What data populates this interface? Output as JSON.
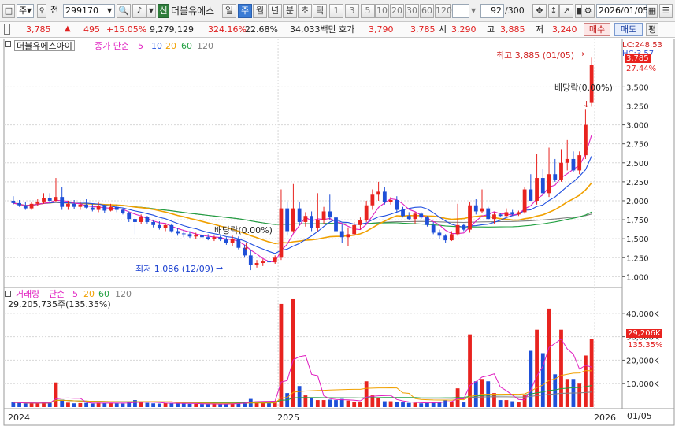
{
  "toolbar": {
    "market": "주",
    "prev_label": "전",
    "code": "299170",
    "sin_badge": "신",
    "stock_name": "더블유에스",
    "periods": [
      "일",
      "주",
      "월",
      "년",
      "분",
      "초",
      "틱"
    ],
    "active_period": "주",
    "minutes": [
      "1",
      "3",
      "5",
      "10",
      "20",
      "30",
      "60",
      "120"
    ],
    "count": "92",
    "total": "/300",
    "date": "2026/01/05"
  },
  "quote": {
    "price": "3,785",
    "change": "495",
    "change_pct": "+15.05%",
    "volume": "9,279,129",
    "vol_ratio": "324.16%",
    "turnover": "22.68%",
    "amount": "34,033백만",
    "ask_label": "호가",
    "ask": "3,790",
    "bid": "3,785",
    "open_label": "시",
    "open": "3,290",
    "high_label": "고",
    "high": "3,885",
    "low_label": "저",
    "low": "3,240",
    "buy_label": "매수",
    "sell_label": "매도",
    "eval_label": "평"
  },
  "price_panel": {
    "title": "더블유에스아이",
    "ma_label": "종가 단순",
    "ma_periods": [
      "5",
      "10",
      "20",
      "60",
      "120"
    ],
    "ma_colors": [
      "#e020c0",
      "#2050e0",
      "#f0a000",
      "#20a040",
      "#808080"
    ],
    "lc_label": "LC:248.53",
    "hc_label": "HC:3.57",
    "cur_price": "3,785",
    "cur_pct": "27.44%",
    "high_annot": "최고 3,885 (01/05)",
    "low_annot": "최저 1,086 (12/09)",
    "div_annot_right": "배당락(0.00%)",
    "div_annot_left": "배당락(0.00%)",
    "y_ticks": [
      "3,500",
      "3,250",
      "3,000",
      "2,750",
      "2,500",
      "2,250",
      "2,000",
      "1,750",
      "1,500",
      "1,250",
      "1,000"
    ]
  },
  "volume_panel": {
    "title": "거래량",
    "ma_label": "단순",
    "ma_periods": [
      "5",
      "20",
      "60",
      "120"
    ],
    "ma_colors": [
      "#e020c0",
      "#f0a000",
      "#20a040",
      "#808080"
    ],
    "summary": "29,205,735주(135.35%)",
    "cur_vol": "29,206K",
    "cur_pct": "135.35%",
    "y_ticks": [
      "40,000K",
      "30,000K",
      "20,000K",
      "10,000K"
    ]
  },
  "x_axis": {
    "labels": [
      "2024",
      "2025",
      "2026"
    ],
    "right_label": "01/05"
  },
  "colors": {
    "up": "#e8231f",
    "down": "#1e4fd8",
    "grid": "#d8d8d8",
    "panel_border": "#9a9a9a"
  },
  "chart_data": {
    "type": "candlestick",
    "period": "weekly",
    "x_range": [
      "2023-12",
      "2026-01-05"
    ],
    "price_ylim": [
      900,
      3950
    ],
    "volume_ylim": [
      0,
      47000
    ],
    "units": {
      "price": "KRW",
      "volume": "thousand shares"
    },
    "candles": [
      {
        "o": 2000,
        "h": 2060,
        "l": 1950,
        "c": 1970,
        "v": 2000
      },
      {
        "o": 1970,
        "h": 2010,
        "l": 1920,
        "c": 1940,
        "v": 1800
      },
      {
        "o": 1940,
        "h": 1990,
        "l": 1880,
        "c": 1900,
        "v": 1500
      },
      {
        "o": 1900,
        "h": 1990,
        "l": 1880,
        "c": 1960,
        "v": 1700
      },
      {
        "o": 1960,
        "h": 2020,
        "l": 1930,
        "c": 1990,
        "v": 1600
      },
      {
        "o": 1990,
        "h": 2100,
        "l": 1960,
        "c": 2040,
        "v": 2100
      },
      {
        "o": 2040,
        "h": 2100,
        "l": 1980,
        "c": 2000,
        "v": 1800
      },
      {
        "o": 2000,
        "h": 2300,
        "l": 1980,
        "c": 2050,
        "v": 10500
      },
      {
        "o": 2050,
        "h": 2180,
        "l": 1880,
        "c": 1920,
        "v": 3200
      },
      {
        "o": 1920,
        "h": 2000,
        "l": 1880,
        "c": 1960,
        "v": 1900
      },
      {
        "o": 1960,
        "h": 2010,
        "l": 1890,
        "c": 1920,
        "v": 1600
      },
      {
        "o": 1920,
        "h": 1980,
        "l": 1880,
        "c": 1950,
        "v": 1700
      },
      {
        "o": 1950,
        "h": 2020,
        "l": 1900,
        "c": 1910,
        "v": 1800
      },
      {
        "o": 1910,
        "h": 1960,
        "l": 1860,
        "c": 1880,
        "v": 1500
      },
      {
        "o": 1880,
        "h": 1990,
        "l": 1850,
        "c": 1930,
        "v": 1900
      },
      {
        "o": 1930,
        "h": 1950,
        "l": 1840,
        "c": 1870,
        "v": 1700
      },
      {
        "o": 1870,
        "h": 1960,
        "l": 1860,
        "c": 1920,
        "v": 1800
      },
      {
        "o": 1920,
        "h": 1950,
        "l": 1850,
        "c": 1880,
        "v": 1600
      },
      {
        "o": 1880,
        "h": 1900,
        "l": 1820,
        "c": 1840,
        "v": 1500
      },
      {
        "o": 1840,
        "h": 1860,
        "l": 1720,
        "c": 1760,
        "v": 2100
      },
      {
        "o": 1760,
        "h": 1780,
        "l": 1560,
        "c": 1720,
        "v": 3000
      },
      {
        "o": 1720,
        "h": 1820,
        "l": 1690,
        "c": 1790,
        "v": 2000
      },
      {
        "o": 1790,
        "h": 1800,
        "l": 1700,
        "c": 1720,
        "v": 1800
      },
      {
        "o": 1720,
        "h": 1740,
        "l": 1650,
        "c": 1680,
        "v": 1600
      },
      {
        "o": 1680,
        "h": 1730,
        "l": 1620,
        "c": 1640,
        "v": 1500
      },
      {
        "o": 1640,
        "h": 1700,
        "l": 1600,
        "c": 1680,
        "v": 1700
      },
      {
        "o": 1680,
        "h": 1700,
        "l": 1580,
        "c": 1600,
        "v": 1800
      },
      {
        "o": 1600,
        "h": 1640,
        "l": 1540,
        "c": 1570,
        "v": 1600
      },
      {
        "o": 1570,
        "h": 1620,
        "l": 1520,
        "c": 1560,
        "v": 1500
      },
      {
        "o": 1560,
        "h": 1600,
        "l": 1510,
        "c": 1530,
        "v": 1400
      },
      {
        "o": 1530,
        "h": 1580,
        "l": 1500,
        "c": 1550,
        "v": 1400
      },
      {
        "o": 1550,
        "h": 1580,
        "l": 1500,
        "c": 1520,
        "v": 1300
      },
      {
        "o": 1520,
        "h": 1560,
        "l": 1480,
        "c": 1500,
        "v": 1300
      },
      {
        "o": 1500,
        "h": 1540,
        "l": 1470,
        "c": 1520,
        "v": 1300
      },
      {
        "o": 1520,
        "h": 1540,
        "l": 1470,
        "c": 1490,
        "v": 1200
      },
      {
        "o": 1490,
        "h": 1520,
        "l": 1420,
        "c": 1440,
        "v": 1400
      },
      {
        "o": 1440,
        "h": 1540,
        "l": 1400,
        "c": 1500,
        "v": 1600
      },
      {
        "o": 1500,
        "h": 1530,
        "l": 1360,
        "c": 1380,
        "v": 2000
      },
      {
        "o": 1380,
        "h": 1420,
        "l": 1250,
        "c": 1280,
        "v": 2300
      },
      {
        "o": 1280,
        "h": 1360,
        "l": 1086,
        "c": 1150,
        "v": 3500
      },
      {
        "o": 1150,
        "h": 1220,
        "l": 1120,
        "c": 1180,
        "v": 2400
      },
      {
        "o": 1180,
        "h": 1230,
        "l": 1140,
        "c": 1200,
        "v": 2000
      },
      {
        "o": 1200,
        "h": 1260,
        "l": 1160,
        "c": 1190,
        "v": 2200
      },
      {
        "o": 1190,
        "h": 1280,
        "l": 1170,
        "c": 1250,
        "v": 2600
      },
      {
        "o": 1250,
        "h": 2150,
        "l": 1220,
        "c": 1900,
        "v": 44000
      },
      {
        "o": 1900,
        "h": 1980,
        "l": 1540,
        "c": 1600,
        "v": 6000
      },
      {
        "o": 1600,
        "h": 2220,
        "l": 1580,
        "c": 1900,
        "v": 46000
      },
      {
        "o": 1900,
        "h": 1990,
        "l": 1680,
        "c": 1720,
        "v": 9000
      },
      {
        "o": 1720,
        "h": 1850,
        "l": 1660,
        "c": 1800,
        "v": 5000
      },
      {
        "o": 1800,
        "h": 1860,
        "l": 1600,
        "c": 1640,
        "v": 4000
      },
      {
        "o": 1640,
        "h": 2100,
        "l": 1600,
        "c": 1750,
        "v": 3000
      },
      {
        "o": 1750,
        "h": 1920,
        "l": 1700,
        "c": 1860,
        "v": 3000
      },
      {
        "o": 1860,
        "h": 2080,
        "l": 1750,
        "c": 1780,
        "v": 3200
      },
      {
        "o": 1780,
        "h": 1920,
        "l": 1560,
        "c": 1600,
        "v": 3000
      },
      {
        "o": 1600,
        "h": 1700,
        "l": 1440,
        "c": 1520,
        "v": 3500
      },
      {
        "o": 1520,
        "h": 1650,
        "l": 1400,
        "c": 1560,
        "v": 2800
      },
      {
        "o": 1560,
        "h": 1720,
        "l": 1540,
        "c": 1680,
        "v": 2200
      },
      {
        "o": 1680,
        "h": 1780,
        "l": 1620,
        "c": 1740,
        "v": 2000
      },
      {
        "o": 1740,
        "h": 2000,
        "l": 1720,
        "c": 1940,
        "v": 11000
      },
      {
        "o": 1940,
        "h": 2150,
        "l": 1880,
        "c": 2080,
        "v": 5000
      },
      {
        "o": 2080,
        "h": 2250,
        "l": 2000,
        "c": 2120,
        "v": 4000
      },
      {
        "o": 2120,
        "h": 2180,
        "l": 1950,
        "c": 1980,
        "v": 2500
      },
      {
        "o": 1980,
        "h": 2050,
        "l": 1950,
        "c": 2010,
        "v": 2500
      },
      {
        "o": 2010,
        "h": 2060,
        "l": 1850,
        "c": 1880,
        "v": 2200
      },
      {
        "o": 1880,
        "h": 1920,
        "l": 1780,
        "c": 1800,
        "v": 2000
      },
      {
        "o": 1800,
        "h": 1850,
        "l": 1740,
        "c": 1760,
        "v": 1800
      },
      {
        "o": 1760,
        "h": 1850,
        "l": 1700,
        "c": 1830,
        "v": 1800
      },
      {
        "o": 1830,
        "h": 1850,
        "l": 1760,
        "c": 1780,
        "v": 1600
      },
      {
        "o": 1780,
        "h": 1800,
        "l": 1660,
        "c": 1680,
        "v": 1900
      },
      {
        "o": 1680,
        "h": 1720,
        "l": 1560,
        "c": 1580,
        "v": 2200
      },
      {
        "o": 1580,
        "h": 1620,
        "l": 1500,
        "c": 1540,
        "v": 2300
      },
      {
        "o": 1540,
        "h": 1560,
        "l": 1450,
        "c": 1480,
        "v": 3100
      },
      {
        "o": 1480,
        "h": 1600,
        "l": 1470,
        "c": 1560,
        "v": 2200
      },
      {
        "o": 1560,
        "h": 1960,
        "l": 1540,
        "c": 1680,
        "v": 8000
      },
      {
        "o": 1680,
        "h": 1700,
        "l": 1600,
        "c": 1620,
        "v": 2000
      },
      {
        "o": 1620,
        "h": 1990,
        "l": 1580,
        "c": 1940,
        "v": 31000
      },
      {
        "o": 1940,
        "h": 2020,
        "l": 1820,
        "c": 1860,
        "v": 11000
      },
      {
        "o": 1860,
        "h": 2150,
        "l": 1840,
        "c": 1900,
        "v": 12000
      },
      {
        "o": 1900,
        "h": 1920,
        "l": 1740,
        "c": 1760,
        "v": 11000
      },
      {
        "o": 1760,
        "h": 1850,
        "l": 1700,
        "c": 1820,
        "v": 6000
      },
      {
        "o": 1820,
        "h": 1840,
        "l": 1780,
        "c": 1800,
        "v": 3000
      },
      {
        "o": 1800,
        "h": 1900,
        "l": 1790,
        "c": 1850,
        "v": 3000
      },
      {
        "o": 1850,
        "h": 1880,
        "l": 1800,
        "c": 1820,
        "v": 2500
      },
      {
        "o": 1820,
        "h": 1870,
        "l": 1800,
        "c": 1850,
        "v": 2000
      },
      {
        "o": 1850,
        "h": 2180,
        "l": 1830,
        "c": 2150,
        "v": 5000
      },
      {
        "o": 2150,
        "h": 2350,
        "l": 2050,
        "c": 2000,
        "v": 24000
      },
      {
        "o": 2000,
        "h": 2620,
        "l": 1950,
        "c": 2300,
        "v": 33000
      },
      {
        "o": 2300,
        "h": 2420,
        "l": 2080,
        "c": 2100,
        "v": 23000
      },
      {
        "o": 2100,
        "h": 2700,
        "l": 2050,
        "c": 2350,
        "v": 42000
      },
      {
        "o": 2350,
        "h": 2550,
        "l": 2250,
        "c": 2280,
        "v": 14000
      },
      {
        "o": 2280,
        "h": 2680,
        "l": 2250,
        "c": 2500,
        "v": 33000
      },
      {
        "o": 2500,
        "h": 2800,
        "l": 2400,
        "c": 2550,
        "v": 12000
      },
      {
        "o": 2550,
        "h": 2650,
        "l": 2380,
        "c": 2400,
        "v": 12000
      },
      {
        "o": 2400,
        "h": 2650,
        "l": 2350,
        "c": 2600,
        "v": 10000
      },
      {
        "o": 2600,
        "h": 3200,
        "l": 2550,
        "c": 3000,
        "v": 22000
      },
      {
        "o": 3290,
        "h": 3885,
        "l": 3240,
        "c": 3785,
        "v": 29206
      }
    ]
  }
}
